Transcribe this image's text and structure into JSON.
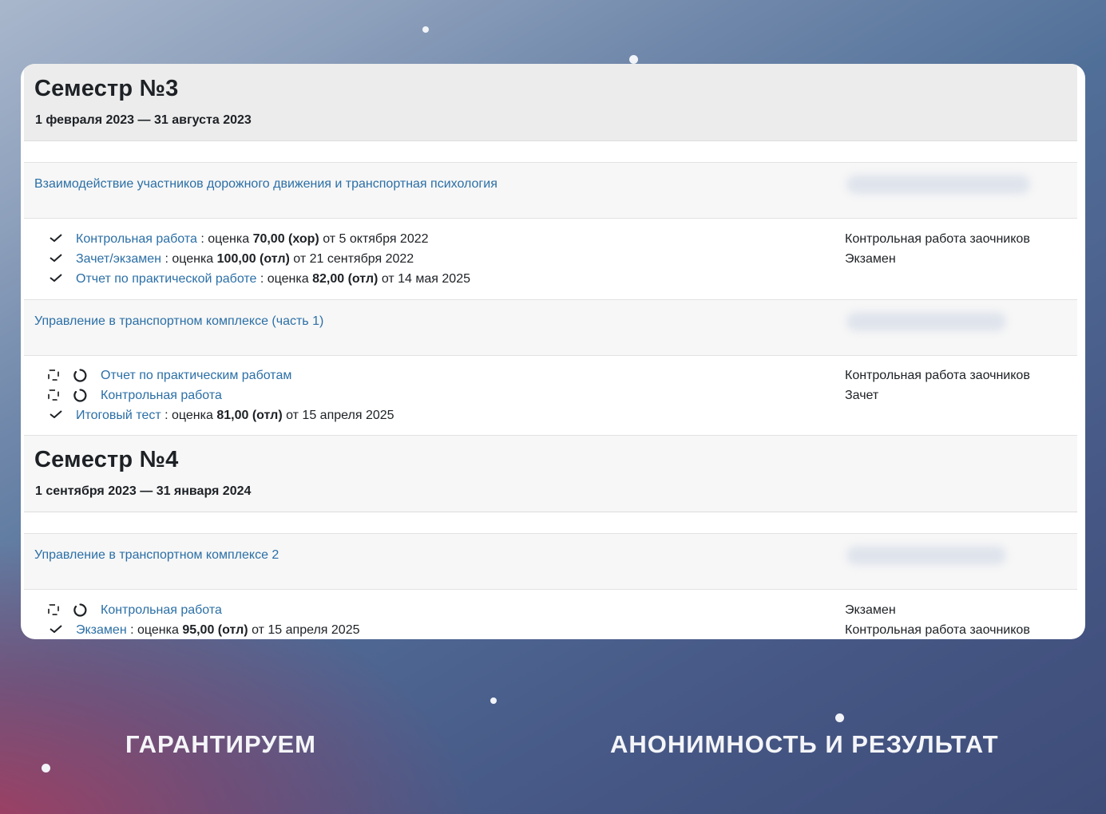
{
  "colors": {
    "link": "#2b6fa6",
    "text": "#1d2125",
    "accent_bottom": "#aa3a5c"
  },
  "semesters": [
    {
      "title": "Семестр №3",
      "dates": "1 февраля 2023 — 31 августа 2023",
      "courses": [
        {
          "name": "Взаимодействие участников дорожного движения и транспортная психология",
          "items": [
            {
              "status": "check-icon",
              "link": "Контрольная работа",
              "pre": " : оценка ",
              "grade": "70,00 (хор)",
              "post": " от 5 октября 2022",
              "right": "Контрольная работа заочников"
            },
            {
              "status": "check-icon",
              "link": "Зачет/экзамен",
              "pre": " : оценка ",
              "grade": "100,00 (отл)",
              "post": " от 21 сентября 2022",
              "right": "Экзамен"
            },
            {
              "status": "check-icon",
              "link": "Отчет по практической работе",
              "pre": " : оценка ",
              "grade": "82,00 (отл)",
              "post": " от 14 мая 2025",
              "right": ""
            }
          ]
        },
        {
          "name": "Управление в транспортном комплексе (часть 1)",
          "items": [
            {
              "status": "pending",
              "link": "Отчет по практическим работам",
              "right": "Контрольная работа заочников"
            },
            {
              "status": "pending",
              "link": "Контрольная работа",
              "right": "Зачет"
            },
            {
              "status": "check-icon",
              "link": "Итоговый тест",
              "pre": " : оценка ",
              "grade": "81,00 (отл)",
              "post": " от 15 апреля 2025",
              "right": ""
            }
          ]
        }
      ]
    },
    {
      "title": "Семестр №4",
      "dates": "1 сентября 2023 — 31 января 2024",
      "courses": [
        {
          "name": "Управление в транспортном комплексе 2",
          "items": [
            {
              "status": "pending",
              "link": "Контрольная работа",
              "right": "Экзамен"
            },
            {
              "status": "check-icon",
              "link": "Экзамен",
              "pre": " : оценка ",
              "grade": "95,00 (отл)",
              "post": " от 15 апреля 2025",
              "right": "Контрольная работа заочников"
            }
          ]
        }
      ]
    }
  ],
  "bottom": {
    "left": "ГАРАНТИРУЕМ",
    "right": "АНОНИМНОСТЬ И РЕЗУЛЬТАТ"
  }
}
